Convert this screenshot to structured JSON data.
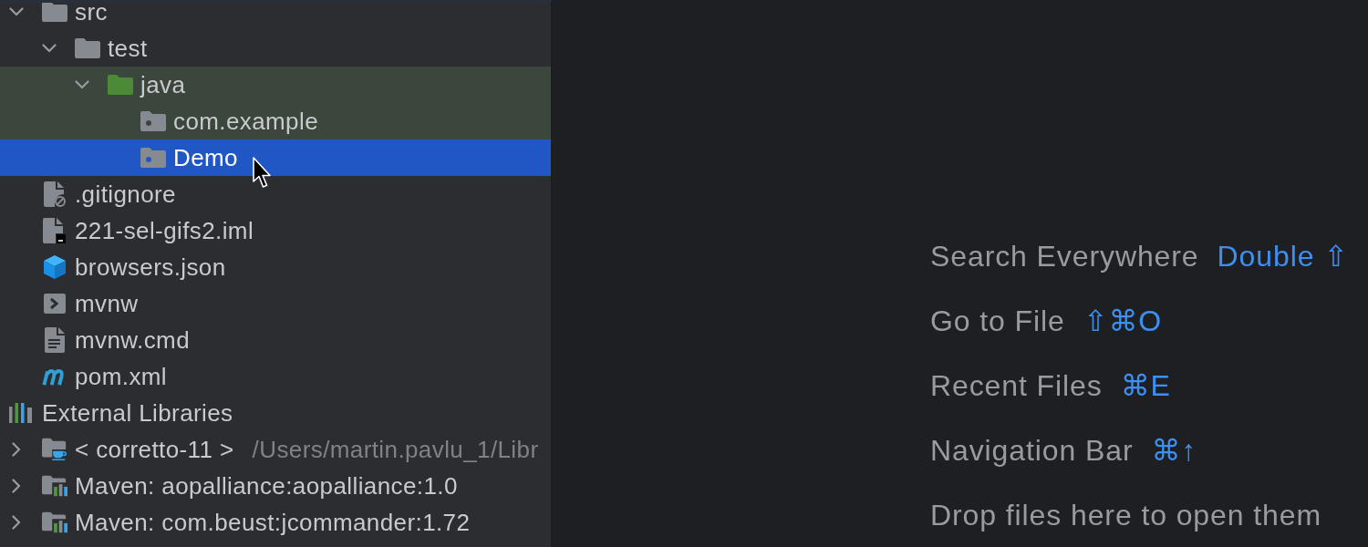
{
  "project_tree": [
    {
      "label": "src",
      "kind": "folder",
      "expanded": true,
      "selected": false,
      "highlighted": false,
      "children": [
        {
          "label": "test",
          "kind": "folder",
          "expanded": true,
          "selected": false,
          "highlighted": false,
          "children": [
            {
              "label": "java",
              "kind": "test-root",
              "expanded": true,
              "selected": false,
              "highlighted": true,
              "children": [
                {
                  "label": "com.example",
                  "kind": "package",
                  "selected": false,
                  "highlighted": true
                },
                {
                  "label": "Demo",
                  "kind": "package",
                  "selected": true,
                  "highlighted": false
                }
              ]
            }
          ]
        }
      ]
    },
    {
      "label": ".gitignore",
      "kind": "ignore-file",
      "selected": false,
      "highlighted": false
    },
    {
      "label": "221-sel-gifs2.iml",
      "kind": "module-file",
      "selected": false,
      "highlighted": false
    },
    {
      "label": "browsers.json",
      "kind": "json-file",
      "selected": false,
      "highlighted": false
    },
    {
      "label": "mvnw",
      "kind": "shell-script",
      "selected": false,
      "highlighted": false
    },
    {
      "label": "mvnw.cmd",
      "kind": "text-file",
      "selected": false,
      "highlighted": false
    },
    {
      "label": "pom.xml",
      "kind": "maven-file",
      "selected": false,
      "highlighted": false
    }
  ],
  "external_libraries": {
    "label": "External Libraries",
    "kind": "libraries",
    "selected": false,
    "highlighted": false,
    "children": [
      {
        "label": "< corretto-11 >",
        "detail": "/Users/martin.pavlu_1/Libr",
        "kind": "jdk",
        "expanded": false,
        "selected": false,
        "highlighted": false
      },
      {
        "label": "Maven: aopalliance:aopalliance:1.0",
        "kind": "maven-library",
        "expanded": false,
        "selected": false,
        "highlighted": false
      },
      {
        "label": "Maven: com.beust:jcommander:1.72",
        "kind": "maven-library",
        "expanded": false,
        "selected": false,
        "highlighted": false
      }
    ]
  },
  "editor_hints": [
    {
      "label": "Search Everywhere",
      "shortcut": "Double ⇧"
    },
    {
      "label": "Go to File",
      "shortcut": "⇧⌘O"
    },
    {
      "label": "Recent Files",
      "shortcut": "⌘E"
    },
    {
      "label": "Navigation Bar",
      "shortcut": "⌘↑"
    },
    {
      "label": "Drop files here to open them"
    }
  ]
}
